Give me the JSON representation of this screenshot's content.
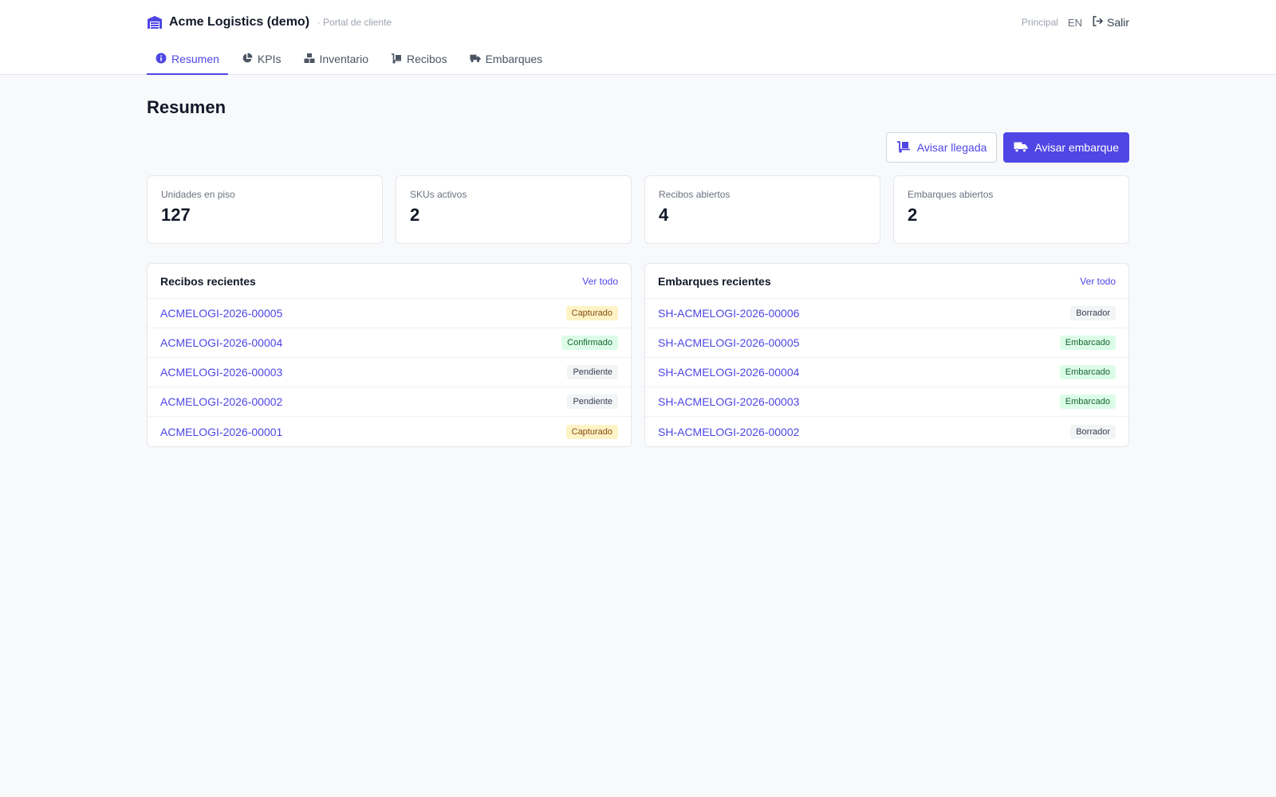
{
  "header": {
    "brand_name": "Acme Logistics (demo)",
    "brand_sub": "Portal de cliente",
    "brand_sub_sep": "·",
    "home_link": "Principal",
    "lang": "EN",
    "logout": "Salir"
  },
  "tabs": [
    {
      "label": "Resumen",
      "icon": "info-icon",
      "active": true
    },
    {
      "label": "KPIs",
      "icon": "pie-chart-icon",
      "active": false
    },
    {
      "label": "Inventario",
      "icon": "boxes-icon",
      "active": false
    },
    {
      "label": "Recibos",
      "icon": "dolly-icon",
      "active": false
    },
    {
      "label": "Embarques",
      "icon": "truck-icon",
      "active": false
    }
  ],
  "page": {
    "title": "Resumen"
  },
  "actions": {
    "notify_arrival": "Avisar llegada",
    "notify_shipment": "Avisar embarque"
  },
  "stats": [
    {
      "label": "Unidades en piso",
      "value": "127"
    },
    {
      "label": "SKUs activos",
      "value": "2"
    },
    {
      "label": "Recibos abiertos",
      "value": "4"
    },
    {
      "label": "Embarques abiertos",
      "value": "2"
    }
  ],
  "receipts": {
    "title": "Recibos recientes",
    "view_all": "Ver todo",
    "rows": [
      {
        "id": "ACMELOGI-2026-00005",
        "status": "Capturado",
        "tone": "yellow"
      },
      {
        "id": "ACMELOGI-2026-00004",
        "status": "Confirmado",
        "tone": "green"
      },
      {
        "id": "ACMELOGI-2026-00003",
        "status": "Pendiente",
        "tone": "gray"
      },
      {
        "id": "ACMELOGI-2026-00002",
        "status": "Pendiente",
        "tone": "gray"
      },
      {
        "id": "ACMELOGI-2026-00001",
        "status": "Capturado",
        "tone": "yellow"
      }
    ]
  },
  "shipments": {
    "title": "Embarques recientes",
    "view_all": "Ver todo",
    "rows": [
      {
        "id": "SH-ACMELOGI-2026-00006",
        "status": "Borrador",
        "tone": "gray"
      },
      {
        "id": "SH-ACMELOGI-2026-00005",
        "status": "Embarcado",
        "tone": "green"
      },
      {
        "id": "SH-ACMELOGI-2026-00004",
        "status": "Embarcado",
        "tone": "green"
      },
      {
        "id": "SH-ACMELOGI-2026-00003",
        "status": "Embarcado",
        "tone": "green"
      },
      {
        "id": "SH-ACMELOGI-2026-00002",
        "status": "Borrador",
        "tone": "gray"
      }
    ]
  },
  "colors": {
    "accent": "#4f46e5",
    "badge_yellow": "#fef3c7",
    "badge_green": "#dcfce7",
    "badge_gray": "#f3f4f6"
  }
}
